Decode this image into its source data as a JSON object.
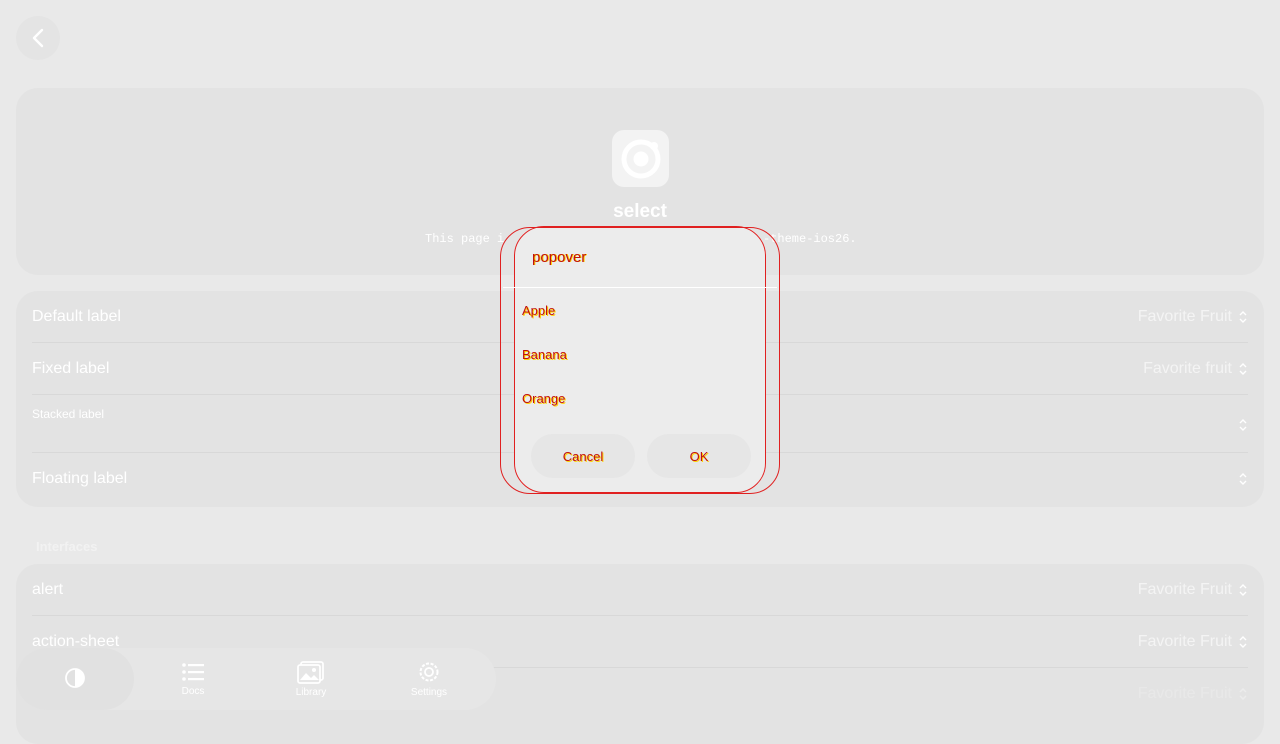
{
  "hero": {
    "title": "select",
    "description_left": "This page i",
    "description_right": "-theme-ios26."
  },
  "list_primary": [
    {
      "label": "Default label",
      "value": "Favorite Fruit"
    },
    {
      "label": "Fixed label",
      "value": "Favorite fruit"
    },
    {
      "label": "Stacked label",
      "value": ""
    },
    {
      "label": "Floating label",
      "value": ""
    }
  ],
  "section": {
    "heading": "Interfaces"
  },
  "list_interfaces": [
    {
      "label": "alert",
      "value": "Favorite Fruit"
    },
    {
      "label": "action-sheet",
      "value": "Favorite Fruit"
    },
    {
      "label": "",
      "value": "Favorite Fruit"
    }
  ],
  "tabbar": {
    "tabs": [
      {
        "label": "",
        "icon": "theme-icon"
      },
      {
        "label": "Docs",
        "icon": "list-icon"
      },
      {
        "label": "Library",
        "icon": "image-icon"
      },
      {
        "label": "Settings",
        "icon": "gear-icon"
      }
    ]
  },
  "popover": {
    "title": "popover",
    "options": [
      "Apple",
      "Banana",
      "Orange"
    ],
    "cancel_label": "Cancel",
    "ok_label": "OK"
  }
}
